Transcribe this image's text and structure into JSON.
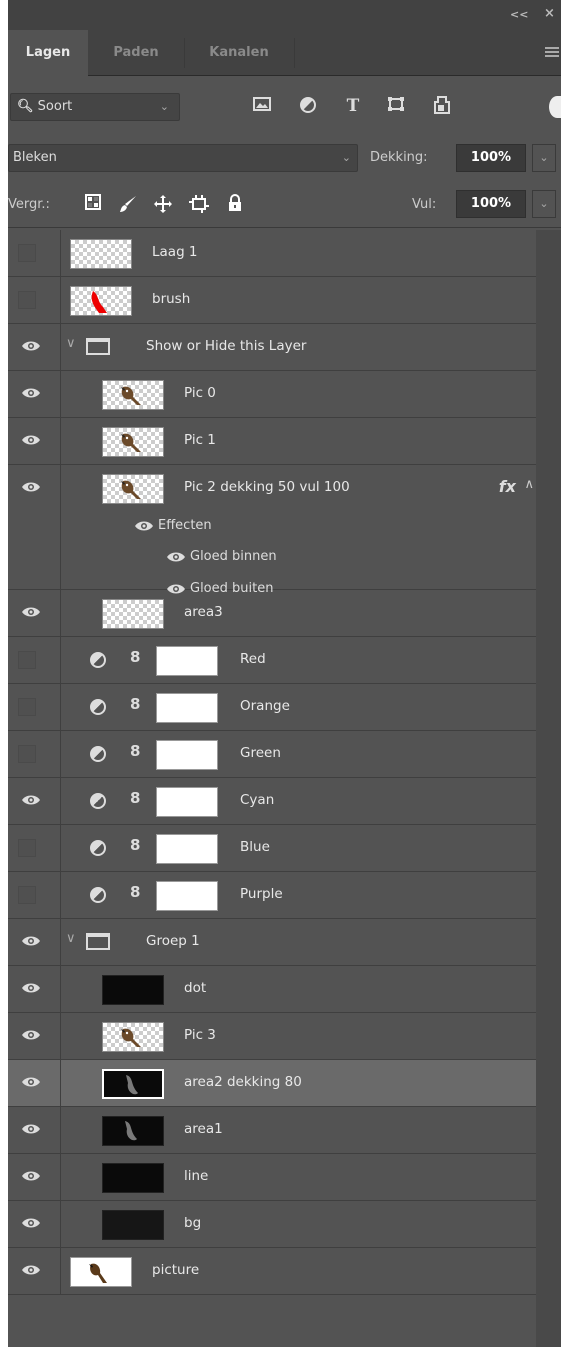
{
  "window": {
    "collapse_label": "<<",
    "close_label": "×"
  },
  "tabs": [
    {
      "label": "Lagen",
      "active": true
    },
    {
      "label": "Paden",
      "active": false
    },
    {
      "label": "Kanalen",
      "active": false
    }
  ],
  "filter": {
    "select_label": "Soort",
    "icons": [
      "image-filter-icon",
      "adjustment-filter-icon",
      "type-filter-icon",
      "shape-filter-icon",
      "smart-object-filter-icon"
    ]
  },
  "blend": {
    "mode": "Bleken",
    "opacity_label": "Dekking:",
    "opacity_value": "100%"
  },
  "lock": {
    "label": "Vergr.:",
    "fill_label": "Vul:",
    "fill_value": "100%"
  },
  "layers": [
    {
      "name": "Laag 1",
      "visible": false,
      "indent": 0,
      "thumb": "checker"
    },
    {
      "name": "brush",
      "visible": false,
      "indent": 0,
      "thumb": "brush"
    },
    {
      "name": "Show or Hide this Layer",
      "visible": true,
      "indent": 0,
      "type": "group"
    },
    {
      "name": "Pic 0",
      "visible": true,
      "indent": 1,
      "thumb": "bird"
    },
    {
      "name": "Pic 1",
      "visible": true,
      "indent": 1,
      "thumb": "bird"
    },
    {
      "name": "Pic 2  dekking 50 vul 100",
      "visible": true,
      "indent": 1,
      "thumb": "bird",
      "fx": "fx",
      "effects_label": "Effecten",
      "effects": [
        "Gloed binnen",
        "Gloed buiten"
      ]
    },
    {
      "name": "area3",
      "visible": true,
      "indent": 1,
      "thumb": "checker"
    },
    {
      "name": "Red",
      "visible": false,
      "indent": 1,
      "type": "adjustment"
    },
    {
      "name": "Orange",
      "visible": false,
      "indent": 1,
      "type": "adjustment"
    },
    {
      "name": "Green",
      "visible": false,
      "indent": 1,
      "type": "adjustment"
    },
    {
      "name": "Cyan",
      "visible": true,
      "indent": 1,
      "type": "adjustment"
    },
    {
      "name": "Blue",
      "visible": false,
      "indent": 1,
      "type": "adjustment"
    },
    {
      "name": "Purple",
      "visible": false,
      "indent": 1,
      "type": "adjustment"
    },
    {
      "name": "Groep 1",
      "visible": true,
      "indent": 0,
      "type": "group"
    },
    {
      "name": "dot",
      "visible": true,
      "indent": 1,
      "thumb": "black"
    },
    {
      "name": "Pic 3",
      "visible": true,
      "indent": 1,
      "thumb": "bird"
    },
    {
      "name": "area2  dekking 80",
      "visible": true,
      "indent": 1,
      "thumb": "smoke",
      "selected": true
    },
    {
      "name": "area1",
      "visible": true,
      "indent": 1,
      "thumb": "smoke"
    },
    {
      "name": "line",
      "visible": true,
      "indent": 1,
      "thumb": "black"
    },
    {
      "name": "bg",
      "visible": true,
      "indent": 1,
      "thumb": "dark"
    },
    {
      "name": "picture",
      "visible": true,
      "indent": 0,
      "thumb": "picture"
    }
  ]
}
